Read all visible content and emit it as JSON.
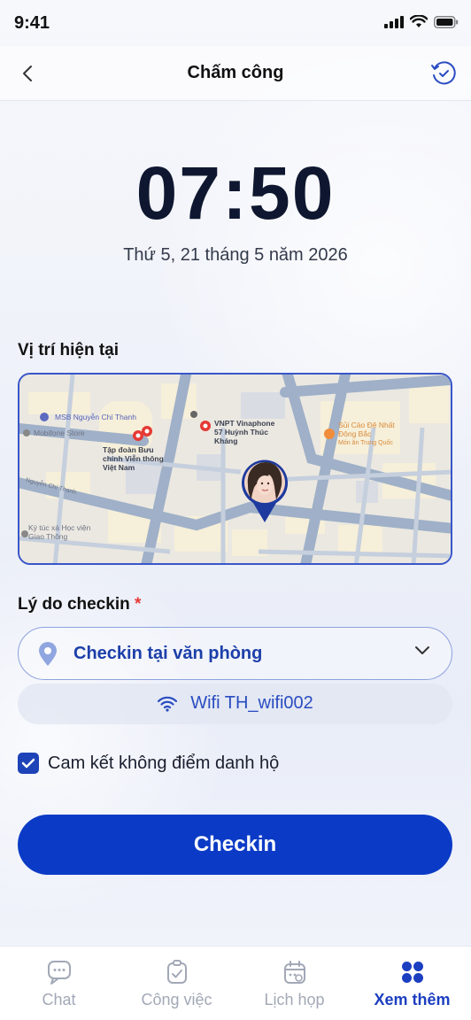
{
  "status": {
    "time": "9:41"
  },
  "header": {
    "title": "Chấm công"
  },
  "clock": {
    "time": "07:50",
    "date": "Thứ 5, 21 tháng 5 năm 2026"
  },
  "location": {
    "label": "Vị trí hiện tại",
    "map_labels": {
      "msb": "MSB Nguyễn Chí Thanh",
      "mobifone": "Mobifone Store",
      "tap_doan": "Tập đoàn Bưu chính Viễn thông Việt Nam",
      "vnpt": "VNPT Vinaphone 57 Huỳnh Thúc Kháng",
      "sui_cao": "Sủi Cảo Đệ Nhất Đông Bắc",
      "sui_cao_sub": "Món ăn Trung Quốc",
      "ky_tuc_xa": "Ký túc xá Học viện Giao Thông",
      "street_left": "Nguyễn Chí Thanh"
    }
  },
  "reason": {
    "label": "Lý do checkin",
    "required_mark": "*",
    "selected": "Checkin tại văn phòng",
    "wifi": "Wifi TH_wifi002"
  },
  "commit": {
    "label": "Cam kết không điểm danh hộ",
    "checked": true
  },
  "checkin_button": {
    "label": "Checkin"
  },
  "nav": {
    "items": [
      {
        "label": "Chat",
        "icon": "chat-icon"
      },
      {
        "label": "Công việc",
        "icon": "task-icon"
      },
      {
        "label": "Lịch họp",
        "icon": "calendar-icon"
      },
      {
        "label": "Xem thêm",
        "icon": "grid-icon",
        "active": true
      }
    ]
  },
  "colors": {
    "primary": "#0b3bc6",
    "accent_text": "#1c3fa9",
    "required": "#e53935"
  }
}
